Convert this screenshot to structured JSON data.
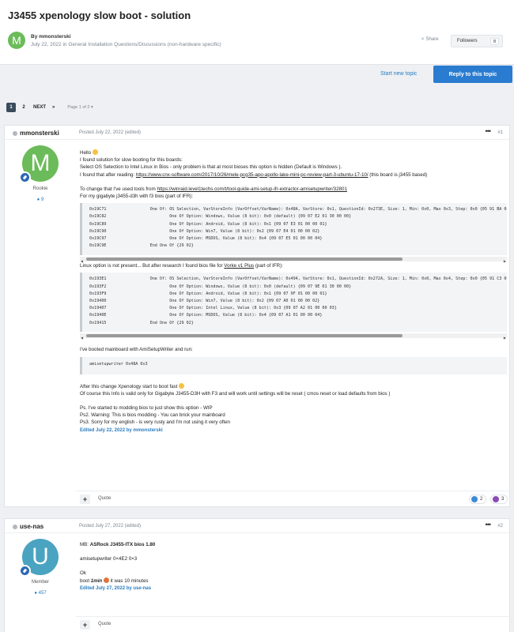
{
  "topic": {
    "title": "J3455 xpenology slow boot - solution",
    "by_line": "By mmonsterski",
    "date_line": "July 22, 2022 in General Installation Questions/Discussions (non-hardware specific)",
    "author_initial": "M",
    "share_label": "Share",
    "followers_label": "Followers",
    "followers_count": "8"
  },
  "actions": {
    "start_new_topic": "Start new topic",
    "reply": "Reply to this topic"
  },
  "pagination": {
    "current": "1",
    "next_page": "2",
    "next_label": "NEXT",
    "last_label": "»",
    "page_of": "Page 1 of 2 ▾"
  },
  "colors": {
    "accent": "#2a7cd0",
    "avatar_green": "#6cbb5a",
    "avatar_teal": "#4aa3c0"
  },
  "posts": [
    {
      "author": "mmonsterski",
      "initial": "M",
      "rank": "Rookie",
      "reputation": "9",
      "posted": "Posted July 22, 2022 (edited)",
      "number": "#1",
      "lines": {
        "hello": "Hello",
        "l1": "I found solution for slow booting for this boards:",
        "l2": "Select OS Selection to Intel Linux in Bios - only problem is that at most bioses this option is hidden (Default is Windows ).",
        "l3a": "I found that after reading: ",
        "l3link": "https://www.cnx-software.com/2017/10/26/mele-pcg35-apo-apollo-lake-mini-pc-review-part-3-ubuntu-17-10/",
        "l3b": " (this board is j3455 based)",
        "l4a": "To change that I've used tools from ",
        "l4link": "https://winraid.level1techs.com/t/tool-guide-ami-setup-ifr-extractor-amisetupwriter/32801",
        "l5": "For my gigabyte j3455-d3h with f3 bios (part of IFR):",
        "l6a": "Linux option is not present... But after research I found bios file for ",
        "l6link": "Vorke v1 Plus",
        "l6b": " (part of IFR):",
        "l7": "I've booted mainboard with AmiSetupWriter and run:",
        "l8": "After this change Xpenology start to boot fast",
        "l9": "Of course this Info is valid only for Gigabyte J3455-D3H with F3 and will work until settings will be reset ( cmos reset or load defaults from bios )",
        "ps1": "Ps. I've started to modding bios to just show this option - WIP",
        "ps2": "Ps2. Warning: This is bios modding - You can brick your mainboard",
        "ps3": "Ps3. Sorry for my english - is very rusty and I'm not using it very often"
      },
      "code1": "0x19C71                  One Of: OS Selection, VarStoreInfo (VarOffset/VarName): 0x48A, VarStore: 0x1, QuestionId: 0x273E, Size: 1, Min: 0x0, Max 0x3, Step: 0x0 {05 91 BA 06 BB 06\n0x19C82                          One Of Option: Windows, Value (8 bit): 0x0 (default) {09 07 E2 01 30 00 00}\n0x19C89                          One Of Option: Android, Value (8 bit): 0x1 {09 07 E3 01 00 00 01}\n0x19C90                          One Of Option: Win7, Value (8 bit): 0x2 {09 07 E4 01 00 00 02}\n0x19C97                          One Of Option: MSDOS, Value (8 bit): 0x4 {09 07 E5 01 00 00 04}\n0x19C9E                  End One Of {29 02}",
      "code2": "0x193E1                  One Of: OS Selection, VarStoreInfo (VarOffset/VarName): 0x494, VarStore: 0x1, QuestionId: 0x272A, Size: 1, Min: 0x0, Max 0x4, Step: 0x0 {05 91 C3 06 C4 06\n0x193F2                          One Of Option: Windows, Value (8 bit): 0x0 (default) {09 07 9E 01 30 00 00}\n0x193F9                          One Of Option: Android, Value (8 bit): 0x1 {09 07 9F 01 00 00 01}\n0x19400                          One Of Option: Win7, Value (8 bit): 0x2 {09 07 A0 01 00 00 02}\n0x19407                          One Of Option: Intel Linux, Value (8 bit): 0x3 {09 07 A2 01 00 00 03}\n0x1940E                          One Of Option: MSDOS, Value (8 bit): 0x4 {09 07 A1 01 00 00 04}\n0x19415                  End One Of {29 02}",
      "code3": "amisetupwriter 0x48A 0x3",
      "edited": "Edited July 22, 2022 by mmonsterski",
      "quote": "Quote",
      "reactions": [
        {
          "icon": "thumbs-up-icon",
          "count": "2",
          "color": "#3b8ad9"
        },
        {
          "icon": "upvote-icon",
          "count": "3",
          "color": "#8a4bb5"
        }
      ]
    },
    {
      "author": "use-nas",
      "initial": "U",
      "rank": "Member",
      "reputation": "457",
      "posted": "Posted July 27, 2022 (edited)",
      "number": "#2",
      "mb_label": "MB: ",
      "mb_value": "ASRock J3455-ITX bios 1.80",
      "cmd": "amisetupwriter 0×4E2 0×3",
      "ok": "Ok",
      "boot_a": "boot ",
      "boot_b": "1min",
      "boot_c": " it was 10 minutes",
      "edited": "Edited July 27, 2022 by use-nas",
      "quote": "Quote"
    }
  ]
}
